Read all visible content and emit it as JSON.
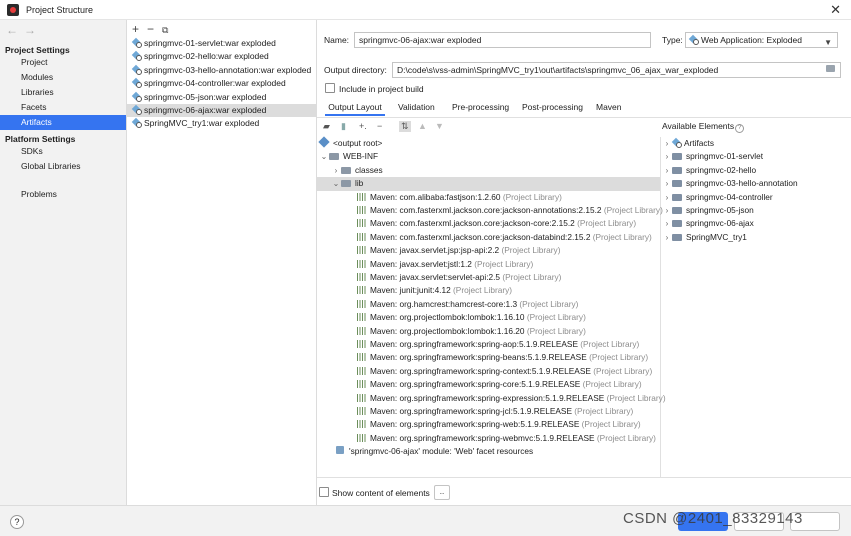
{
  "window": {
    "title": "Project Structure"
  },
  "left_nav": {
    "project_settings_header": "Project Settings",
    "project_items": [
      "Project",
      "Modules",
      "Libraries",
      "Facets",
      "Artifacts"
    ],
    "selected": "Artifacts",
    "platform_settings_header": "Platform Settings",
    "platform_items": [
      "SDKs",
      "Global Libraries"
    ],
    "problems": "Problems"
  },
  "artifacts": [
    "springmvc-01-servlet:war exploded",
    "springmvc-02-hello:war exploded",
    "springmvc-03-hello-annotation:war exploded",
    "springmvc-04-controller:war exploded",
    "springmvc-05-json:war exploded",
    "springmvc-06-ajax:war exploded",
    "SpringMVC_try1:war exploded"
  ],
  "form": {
    "name_label": "Name:",
    "name_value": "springmvc-06-ajax:war exploded",
    "type_label": "Type:",
    "type_value": "Web Application: Exploded",
    "output_label": "Output directory:",
    "output_value": "D:\\code\\s\\vss-admin\\SpringMVC_try1\\out\\artifacts\\springmvc_06_ajax_war_exploded",
    "include_label": "Include in project build"
  },
  "tabs": [
    "Output Layout",
    "Validation",
    "Pre-processing",
    "Post-processing",
    "Maven"
  ],
  "tree": {
    "root": "<output root>",
    "webinf": "WEB-INF",
    "classes": "classes",
    "lib": "lib",
    "libraries": [
      {
        "name": "Maven: com.alibaba:fastjson:1.2.60",
        "suffix": "(Project Library)"
      },
      {
        "name": "Maven: com.fasterxml.jackson.core:jackson-annotations:2.15.2",
        "suffix": "(Project Library)"
      },
      {
        "name": "Maven: com.fasterxml.jackson.core:jackson-core:2.15.2",
        "suffix": "(Project Library)"
      },
      {
        "name": "Maven: com.fasterxml.jackson.core:jackson-databind:2.15.2",
        "suffix": "(Project Library)"
      },
      {
        "name": "Maven: javax.servlet.jsp:jsp-api:2.2",
        "suffix": "(Project Library)"
      },
      {
        "name": "Maven: javax.servlet:jstl:1.2",
        "suffix": "(Project Library)"
      },
      {
        "name": "Maven: javax.servlet:servlet-api:2.5",
        "suffix": "(Project Library)"
      },
      {
        "name": "Maven: junit:junit:4.12",
        "suffix": "(Project Library)"
      },
      {
        "name": "Maven: org.hamcrest:hamcrest-core:1.3",
        "suffix": "(Project Library)"
      },
      {
        "name": "Maven: org.projectlombok:lombok:1.16.10",
        "suffix": "(Project Library)"
      },
      {
        "name": "Maven: org.projectlombok:lombok:1.16.20",
        "suffix": "(Project Library)"
      },
      {
        "name": "Maven: org.springframework:spring-aop:5.1.9.RELEASE",
        "suffix": "(Project Library)"
      },
      {
        "name": "Maven: org.springframework:spring-beans:5.1.9.RELEASE",
        "suffix": "(Project Library)"
      },
      {
        "name": "Maven: org.springframework:spring-context:5.1.9.RELEASE",
        "suffix": "(Project Library)"
      },
      {
        "name": "Maven: org.springframework:spring-core:5.1.9.RELEASE",
        "suffix": "(Project Library)"
      },
      {
        "name": "Maven: org.springframework:spring-expression:5.1.9.RELEASE",
        "suffix": "(Project Library)"
      },
      {
        "name": "Maven: org.springframework:spring-jcl:5.1.9.RELEASE",
        "suffix": "(Project Library)"
      },
      {
        "name": "Maven: org.springframework:spring-web:5.1.9.RELEASE",
        "suffix": "(Project Library)"
      },
      {
        "name": "Maven: org.springframework:spring-webmvc:5.1.9.RELEASE",
        "suffix": "(Project Library)"
      }
    ],
    "facet": "'springmvc-06-ajax' module: 'Web' facet resources"
  },
  "available": {
    "title": "Available Elements",
    "items": [
      "Artifacts",
      "springmvc-01-servlet",
      "springmvc-02-hello",
      "springmvc-03-hello-annotation",
      "springmvc-04-controller",
      "springmvc-05-json",
      "springmvc-06-ajax",
      "SpringMVC_try1"
    ]
  },
  "bottom": {
    "show_content_label": "Show content of elements",
    "more_button": ".."
  },
  "footer": {
    "help": "?",
    "watermark": "CSDN @2401_83329143"
  },
  "colors": {
    "accent": "#3574f0",
    "selection_gray": "#dcdcdc",
    "panel_bg": "#f2f2f2"
  }
}
